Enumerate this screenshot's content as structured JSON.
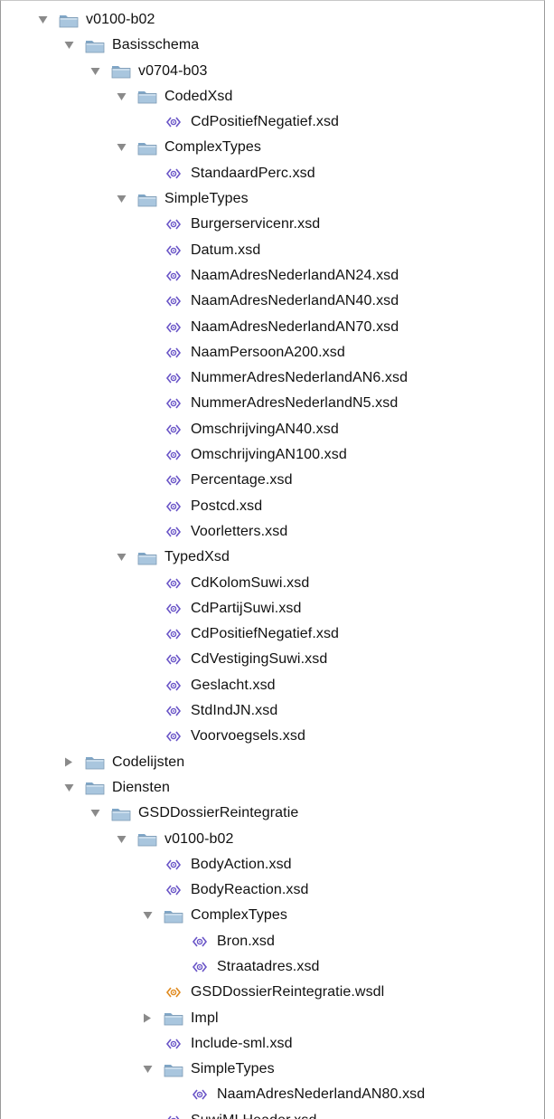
{
  "tree": {
    "rows": [
      {
        "label": "v0100-b02",
        "kind": "folder",
        "depth": 0,
        "expander": "expanded"
      },
      {
        "label": "Basisschema",
        "kind": "folder",
        "depth": 1,
        "expander": "expanded"
      },
      {
        "label": "v0704-b03",
        "kind": "folder",
        "depth": 2,
        "expander": "expanded"
      },
      {
        "label": "CodedXsd",
        "kind": "folder",
        "depth": 3,
        "expander": "expanded"
      },
      {
        "label": "CdPositiefNegatief.xsd",
        "kind": "xsd",
        "depth": 4,
        "expander": "none"
      },
      {
        "label": "ComplexTypes",
        "kind": "folder",
        "depth": 3,
        "expander": "expanded"
      },
      {
        "label": "StandaardPerc.xsd",
        "kind": "xsd",
        "depth": 4,
        "expander": "none"
      },
      {
        "label": "SimpleTypes",
        "kind": "folder",
        "depth": 3,
        "expander": "expanded"
      },
      {
        "label": "Burgerservicenr.xsd",
        "kind": "xsd",
        "depth": 4,
        "expander": "none"
      },
      {
        "label": "Datum.xsd",
        "kind": "xsd",
        "depth": 4,
        "expander": "none"
      },
      {
        "label": "NaamAdresNederlandAN24.xsd",
        "kind": "xsd",
        "depth": 4,
        "expander": "none"
      },
      {
        "label": "NaamAdresNederlandAN40.xsd",
        "kind": "xsd",
        "depth": 4,
        "expander": "none"
      },
      {
        "label": "NaamAdresNederlandAN70.xsd",
        "kind": "xsd",
        "depth": 4,
        "expander": "none"
      },
      {
        "label": "NaamPersoonA200.xsd",
        "kind": "xsd",
        "depth": 4,
        "expander": "none"
      },
      {
        "label": "NummerAdresNederlandAN6.xsd",
        "kind": "xsd",
        "depth": 4,
        "expander": "none"
      },
      {
        "label": "NummerAdresNederlandN5.xsd",
        "kind": "xsd",
        "depth": 4,
        "expander": "none"
      },
      {
        "label": "OmschrijvingAN40.xsd",
        "kind": "xsd",
        "depth": 4,
        "expander": "none"
      },
      {
        "label": "OmschrijvingAN100.xsd",
        "kind": "xsd",
        "depth": 4,
        "expander": "none"
      },
      {
        "label": "Percentage.xsd",
        "kind": "xsd",
        "depth": 4,
        "expander": "none"
      },
      {
        "label": "Postcd.xsd",
        "kind": "xsd",
        "depth": 4,
        "expander": "none"
      },
      {
        "label": "Voorletters.xsd",
        "kind": "xsd",
        "depth": 4,
        "expander": "none"
      },
      {
        "label": "TypedXsd",
        "kind": "folder",
        "depth": 3,
        "expander": "expanded"
      },
      {
        "label": "CdKolomSuwi.xsd",
        "kind": "xsd",
        "depth": 4,
        "expander": "none"
      },
      {
        "label": "CdPartijSuwi.xsd",
        "kind": "xsd",
        "depth": 4,
        "expander": "none"
      },
      {
        "label": "CdPositiefNegatief.xsd",
        "kind": "xsd",
        "depth": 4,
        "expander": "none"
      },
      {
        "label": "CdVestigingSuwi.xsd",
        "kind": "xsd",
        "depth": 4,
        "expander": "none"
      },
      {
        "label": "Geslacht.xsd",
        "kind": "xsd",
        "depth": 4,
        "expander": "none"
      },
      {
        "label": "StdIndJN.xsd",
        "kind": "xsd",
        "depth": 4,
        "expander": "none"
      },
      {
        "label": "Voorvoegsels.xsd",
        "kind": "xsd",
        "depth": 4,
        "expander": "none"
      },
      {
        "label": "Codelijsten",
        "kind": "folder",
        "depth": 1,
        "expander": "collapsed"
      },
      {
        "label": "Diensten",
        "kind": "folder",
        "depth": 1,
        "expander": "expanded"
      },
      {
        "label": "GSDDossierReintegratie",
        "kind": "folder",
        "depth": 2,
        "expander": "expanded"
      },
      {
        "label": "v0100-b02",
        "kind": "folder",
        "depth": 3,
        "expander": "expanded"
      },
      {
        "label": "BodyAction.xsd",
        "kind": "xsd",
        "depth": 4,
        "expander": "none"
      },
      {
        "label": "BodyReaction.xsd",
        "kind": "xsd",
        "depth": 4,
        "expander": "none"
      },
      {
        "label": "ComplexTypes",
        "kind": "folder",
        "depth": 4,
        "expander": "expanded"
      },
      {
        "label": "Bron.xsd",
        "kind": "xsd",
        "depth": 5,
        "expander": "none"
      },
      {
        "label": "Straatadres.xsd",
        "kind": "xsd",
        "depth": 5,
        "expander": "none"
      },
      {
        "label": "GSDDossierReintegratie.wsdl",
        "kind": "wsdl",
        "depth": 4,
        "expander": "none"
      },
      {
        "label": "Impl",
        "kind": "folder",
        "depth": 4,
        "expander": "collapsed"
      },
      {
        "label": "Include-sml.xsd",
        "kind": "xsd",
        "depth": 4,
        "expander": "none"
      },
      {
        "label": "SimpleTypes",
        "kind": "folder",
        "depth": 4,
        "expander": "expanded"
      },
      {
        "label": "NaamAdresNederlandAN80.xsd",
        "kind": "xsd",
        "depth": 5,
        "expander": "none"
      },
      {
        "label": "SuwiMLHeader.xsd",
        "kind": "xsd",
        "depth": 4,
        "expander": "none"
      }
    ]
  },
  "icons": {
    "folder": "folder-icon",
    "xsd": "xsd-file-icon",
    "wsdl": "wsdl-file-icon",
    "expanded": "disclosure-expanded-icon",
    "collapsed": "disclosure-collapsed-icon"
  },
  "colors": {
    "xsd_icon": "#6a55c7",
    "wsdl_icon": "#e08a1e",
    "folder_body": "#a9c6de",
    "folder_tab": "#7fa6c7",
    "disclosure": "#8a8a8a"
  }
}
